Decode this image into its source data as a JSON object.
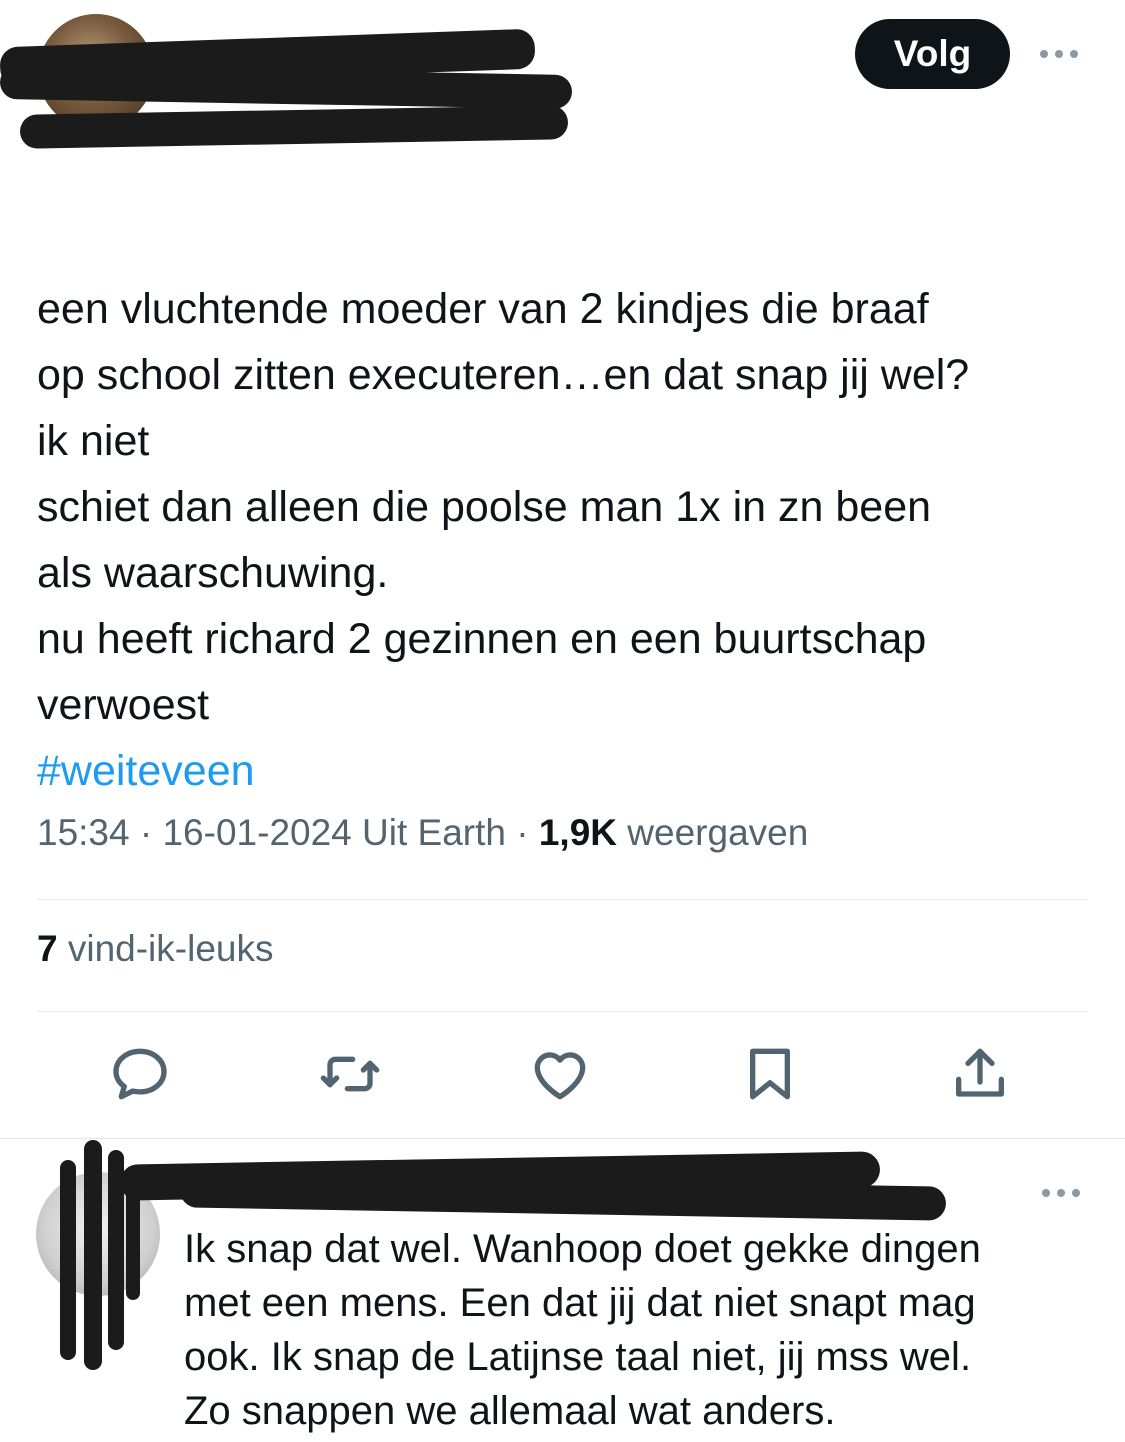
{
  "header": {
    "follow_label": "Volg",
    "more_icon": "more-horizontal-icon"
  },
  "tweet": {
    "text": "een vluchtende moeder van 2 kindjes die braaf\nop school zitten executeren…en dat snap jij wel?\nik niet\nschiet dan alleen die poolse man 1x in zn been\nals waarschuwing.\nnu heeft richard 2 gezinnen en een buurtschap\nverwoest",
    "hashtag": "#weiteveen",
    "time": "15:34",
    "date": "16-01-2024",
    "source": "Uit Earth",
    "views_count": "1,9K",
    "views_label": "weergaven",
    "likes_count": "7",
    "likes_label": "vind-ik-leuks"
  },
  "actions": [
    {
      "name": "reply-icon"
    },
    {
      "name": "repost-icon"
    },
    {
      "name": "like-icon"
    },
    {
      "name": "bookmark-icon"
    },
    {
      "name": "share-icon"
    }
  ],
  "reply": {
    "text": "Ik snap dat wel.  Wanhoop doet gekke dingen\nmet een mens. Een dat jij dat niet snapt mag\nook. Ik snap de Latijnse taal niet,  jij mss wel.\nZo snappen we allemaal wat anders."
  },
  "colors": {
    "text": "#0f1419",
    "muted": "#536471",
    "link": "#1d9bf0",
    "follow_bg": "#0f1419",
    "divider": "#e1e8ed"
  }
}
